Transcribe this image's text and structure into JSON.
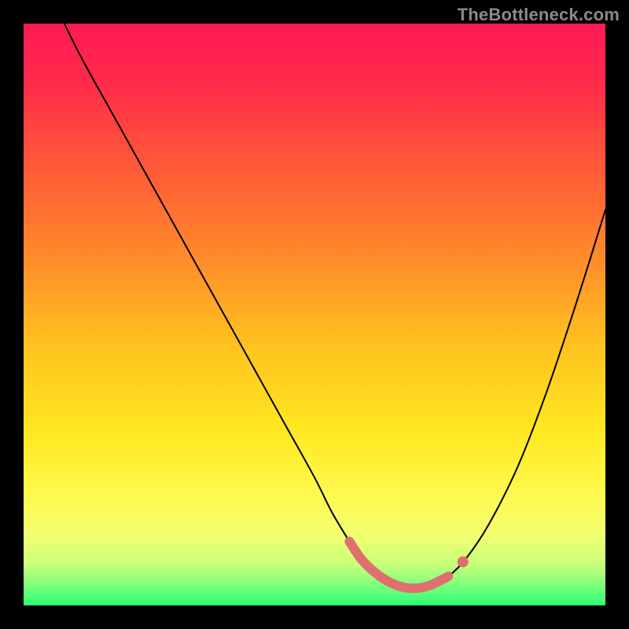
{
  "watermark": "TheBottleneck.com",
  "colors": {
    "frame": "#000000",
    "gradient_stops": [
      {
        "offset": 0.0,
        "color": "#ff1a55"
      },
      {
        "offset": 0.1,
        "color": "#ff2b4a"
      },
      {
        "offset": 0.25,
        "color": "#ff5a38"
      },
      {
        "offset": 0.4,
        "color": "#ff8a2a"
      },
      {
        "offset": 0.55,
        "color": "#ffc11f"
      },
      {
        "offset": 0.7,
        "color": "#ffe820"
      },
      {
        "offset": 0.8,
        "color": "#fff84a"
      },
      {
        "offset": 0.88,
        "color": "#f2ff70"
      },
      {
        "offset": 0.93,
        "color": "#c8ff7a"
      },
      {
        "offset": 0.965,
        "color": "#7eff7a"
      },
      {
        "offset": 1.0,
        "color": "#2bff77"
      }
    ],
    "curve": "#000000",
    "marker": "#e06f6f"
  },
  "chart_data": {
    "type": "line",
    "title": "",
    "xlabel": "",
    "ylabel": "",
    "xlim": [
      0,
      100
    ],
    "ylim": [
      0,
      100
    ],
    "series": [
      {
        "name": "bottleneck_curve",
        "x": [
          7,
          10,
          15,
          20,
          25,
          30,
          35,
          40,
          45,
          50,
          53,
          56,
          58,
          60,
          62,
          64,
          66,
          68,
          70,
          73,
          76,
          80,
          85,
          90,
          95,
          100
        ],
        "values": [
          100,
          94,
          85,
          76,
          67,
          58,
          49,
          40,
          31,
          22,
          16,
          11,
          8,
          6,
          4.5,
          3.5,
          3,
          3,
          3.5,
          5,
          8,
          14,
          24,
          37,
          52,
          68
        ]
      }
    ],
    "flat_region": {
      "x_start": 56,
      "x_end": 73,
      "y_approx": 4
    },
    "annotations": []
  }
}
